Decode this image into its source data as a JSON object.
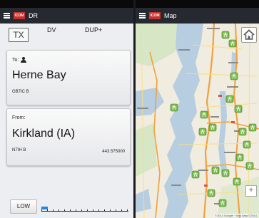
{
  "left_screen": {
    "app_title": "DR",
    "tx_label": "TX",
    "mode_label": "DV",
    "duplex_label": "DUP+",
    "to_card": {
      "heading": "To:",
      "icon": "person-icon",
      "name": "Herne Bay",
      "callsign": "GB7IC  B"
    },
    "from_card": {
      "heading": "From:",
      "name": "Kirkland (IA)",
      "callsign": "N7IH   B",
      "frequency": "443.575000"
    },
    "power_label": "LOW",
    "signal_level": 0.07
  },
  "right_screen": {
    "app_title": "Map",
    "home_icon": "home-icon",
    "zoom_in_label": "+",
    "attribution": "©2014 Google · Map data ©2014"
  },
  "colors": {
    "app_bar": "#262a30",
    "logo": "#c9302c",
    "meter": "#1e88e5",
    "water": "#b7cde0",
    "marker": "#7fbf4f"
  }
}
